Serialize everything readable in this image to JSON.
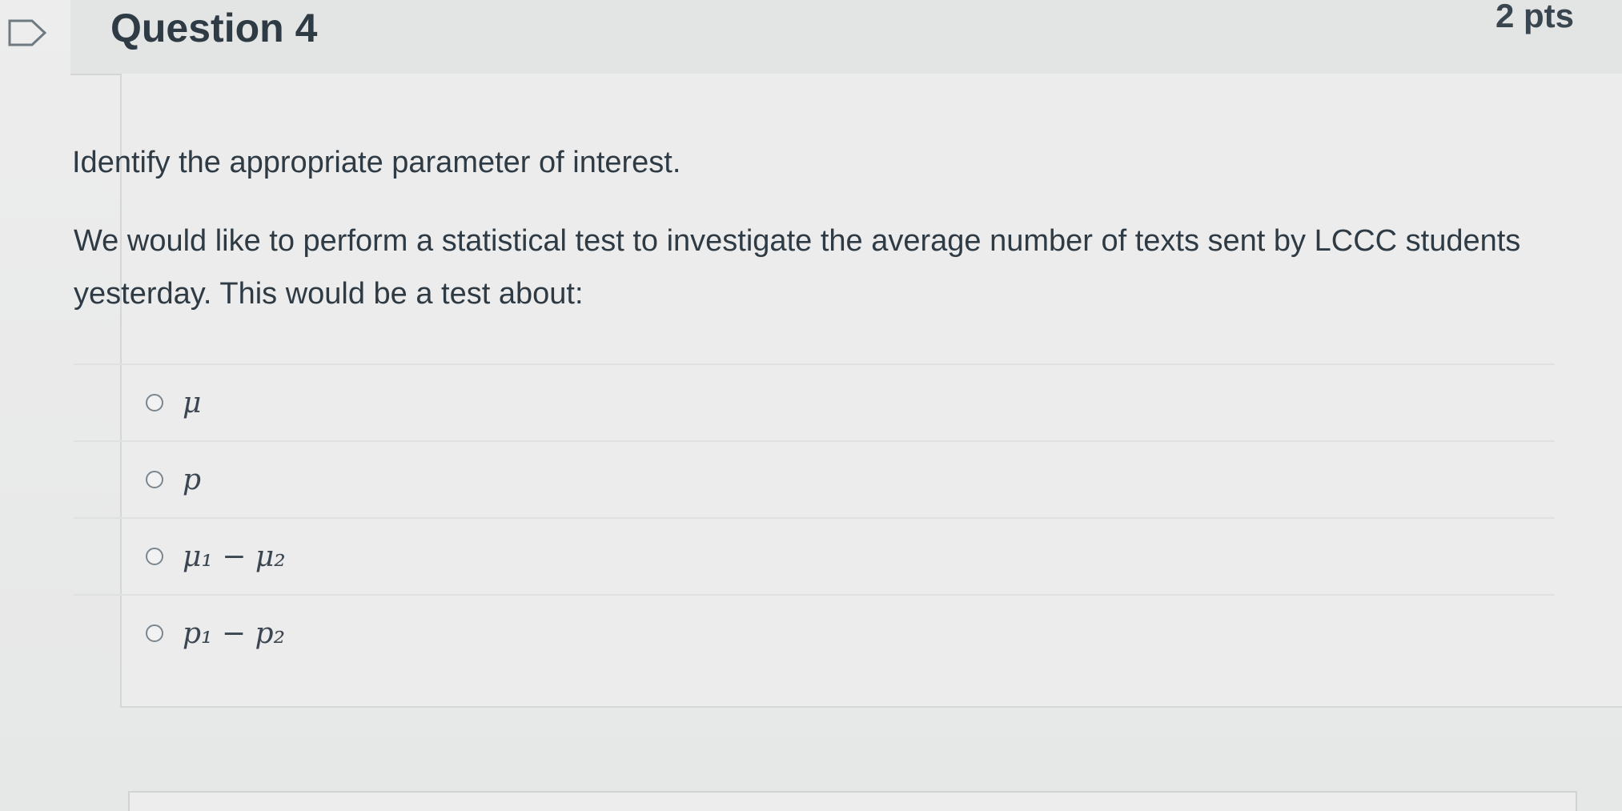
{
  "question": {
    "title": "Question 4",
    "points": "2 pts",
    "prompt": "Identify the appropriate parameter of interest.",
    "description": "We would like to perform a statistical test to investigate the average number of texts sent by LCCC students yesterday. This would be a test about:",
    "answers": [
      {
        "label": "μ"
      },
      {
        "label": "p"
      },
      {
        "label": "μ₁ − μ₂"
      },
      {
        "label": "p₁ − p₂"
      }
    ]
  },
  "icons": {
    "flag": "bookmark-flag-icon"
  }
}
